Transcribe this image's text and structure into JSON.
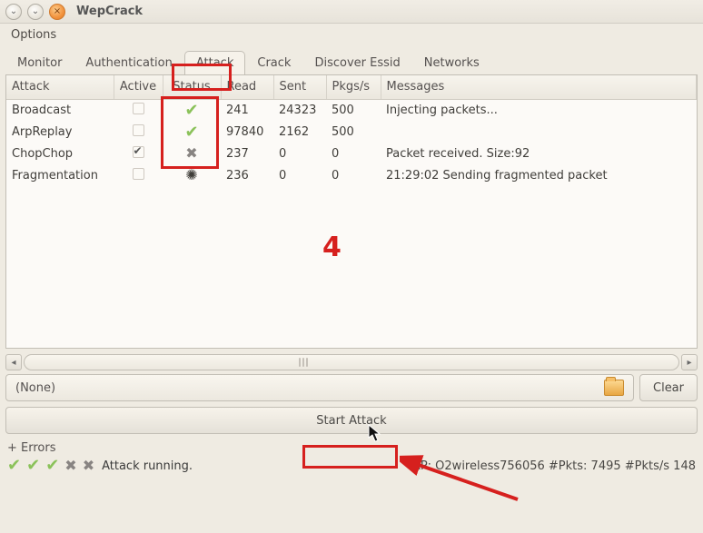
{
  "window": {
    "title": "WepCrack"
  },
  "menubar": {
    "options": "Options"
  },
  "tabs": {
    "monitor": "Monitor",
    "authentication": "Authentication",
    "attack": "Attack",
    "crack": "Crack",
    "discover": "Discover Essid",
    "networks": "Networks",
    "active_tab": "attack"
  },
  "table": {
    "headers": {
      "attack": "Attack",
      "active": "Active",
      "status": "Status",
      "read": "Read",
      "sent": "Sent",
      "pkgs": "Pkgs/s",
      "messages": "Messages"
    },
    "rows": [
      {
        "attack": "Broadcast",
        "active": false,
        "status": "ok",
        "read": "241",
        "sent": "24323",
        "pkgs": "500",
        "msg": "Injecting packets..."
      },
      {
        "attack": "ArpReplay",
        "active": false,
        "status": "ok",
        "read": "97840",
        "sent": "2162",
        "pkgs": "500",
        "msg": ""
      },
      {
        "attack": "ChopChop",
        "active": true,
        "status": "fail",
        "read": "237",
        "sent": "0",
        "pkgs": "0",
        "msg": "Packet received. Size:92"
      },
      {
        "attack": "Fragmentation",
        "active": false,
        "status": "busy",
        "read": "236",
        "sent": "0",
        "pkgs": "0",
        "msg": "21:29:02  Sending fragmented packet"
      }
    ]
  },
  "filerow": {
    "none": "(None)",
    "clear": "Clear"
  },
  "start_button": "Start Attack",
  "errors_label": "+ Errors",
  "statusbar": {
    "text": "Attack running.",
    "ap": "AP: O2wireless756056 #Pkts: 7495 #Pkts/s 148"
  },
  "annotation": {
    "center_number": "4"
  }
}
